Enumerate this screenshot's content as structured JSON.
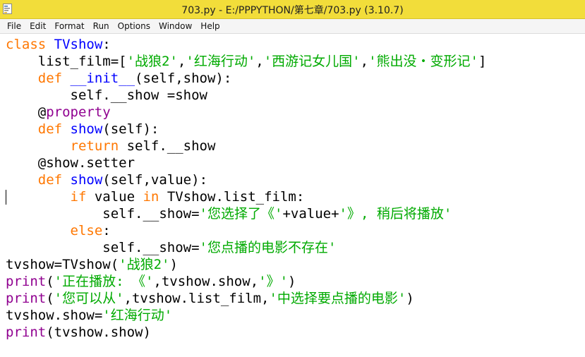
{
  "window": {
    "title": "703.py - E:/PPPYTHON/第七章/703.py (3.10.7)"
  },
  "menu": {
    "items": [
      "File",
      "Edit",
      "Format",
      "Run",
      "Options",
      "Window",
      "Help"
    ]
  },
  "colors": {
    "titlebar": "#f2dd3a",
    "keyword": "#ff7700",
    "definition": "#0000ff",
    "string": "#00aa00",
    "builtin": "#900090"
  },
  "code": {
    "lines": [
      [
        {
          "t": "class ",
          "c": "kw"
        },
        {
          "t": "TVshow",
          "c": "def"
        },
        {
          "t": ":",
          "c": "plain"
        }
      ],
      [
        {
          "t": "    list_film=[",
          "c": "plain"
        },
        {
          "t": "'战狼2'",
          "c": "str"
        },
        {
          "t": ",",
          "c": "plain"
        },
        {
          "t": "'红海行动'",
          "c": "str"
        },
        {
          "t": ",",
          "c": "plain"
        },
        {
          "t": "'西游记女儿国'",
          "c": "str"
        },
        {
          "t": ",",
          "c": "plain"
        },
        {
          "t": "'熊出没・变形记'",
          "c": "str"
        },
        {
          "t": "]",
          "c": "plain"
        }
      ],
      [
        {
          "t": "    ",
          "c": "plain"
        },
        {
          "t": "def ",
          "c": "kw"
        },
        {
          "t": "__init__",
          "c": "def"
        },
        {
          "t": "(self,show):",
          "c": "plain"
        }
      ],
      [
        {
          "t": "        self.__show =show",
          "c": "plain"
        }
      ],
      [
        {
          "t": "    @",
          "c": "plain"
        },
        {
          "t": "property",
          "c": "builtin"
        }
      ],
      [
        {
          "t": "    ",
          "c": "plain"
        },
        {
          "t": "def ",
          "c": "kw"
        },
        {
          "t": "show",
          "c": "def"
        },
        {
          "t": "(self):",
          "c": "plain"
        }
      ],
      [
        {
          "t": "        ",
          "c": "plain"
        },
        {
          "t": "return",
          "c": "kw"
        },
        {
          "t": " self.__show",
          "c": "plain"
        }
      ],
      [
        {
          "t": "    @show.setter",
          "c": "plain"
        }
      ],
      [
        {
          "t": "    ",
          "c": "plain"
        },
        {
          "t": "def ",
          "c": "kw"
        },
        {
          "t": "show",
          "c": "def"
        },
        {
          "t": "(self,value):",
          "c": "plain"
        }
      ],
      [
        {
          "t": "        ",
          "c": "plain"
        },
        {
          "t": "if",
          "c": "kw"
        },
        {
          "t": " value ",
          "c": "plain"
        },
        {
          "t": "in",
          "c": "kw"
        },
        {
          "t": " TVshow.list_film:",
          "c": "plain"
        }
      ],
      [
        {
          "t": "            self.__show=",
          "c": "plain"
        },
        {
          "t": "'您选择了《'",
          "c": "str"
        },
        {
          "t": "+value+",
          "c": "plain"
        },
        {
          "t": "'》, 稍后将播放'",
          "c": "str"
        }
      ],
      [
        {
          "t": "        ",
          "c": "plain"
        },
        {
          "t": "else",
          "c": "kw"
        },
        {
          "t": ":",
          "c": "plain"
        }
      ],
      [
        {
          "t": "            self.__show=",
          "c": "plain"
        },
        {
          "t": "'您点播的电影不存在'",
          "c": "str"
        }
      ],
      [
        {
          "t": "tvshow=TVshow(",
          "c": "plain"
        },
        {
          "t": "'战狼2'",
          "c": "str"
        },
        {
          "t": ")",
          "c": "plain"
        }
      ],
      [
        {
          "t": "print",
          "c": "builtin"
        },
        {
          "t": "(",
          "c": "plain"
        },
        {
          "t": "'正在播放: 《'",
          "c": "str"
        },
        {
          "t": ",tvshow.show,",
          "c": "plain"
        },
        {
          "t": "'》'",
          "c": "str"
        },
        {
          "t": ")",
          "c": "plain"
        }
      ],
      [
        {
          "t": "print",
          "c": "builtin"
        },
        {
          "t": "(",
          "c": "plain"
        },
        {
          "t": "'您可以从'",
          "c": "str"
        },
        {
          "t": ",tvshow.list_film,",
          "c": "plain"
        },
        {
          "t": "'中选择要点播的电影'",
          "c": "str"
        },
        {
          "t": ")",
          "c": "plain"
        }
      ],
      [
        {
          "t": "tvshow.show=",
          "c": "plain"
        },
        {
          "t": "'红海行动'",
          "c": "str"
        }
      ],
      [
        {
          "t": "print",
          "c": "builtin"
        },
        {
          "t": "(tvshow.show)",
          "c": "plain"
        }
      ]
    ]
  }
}
